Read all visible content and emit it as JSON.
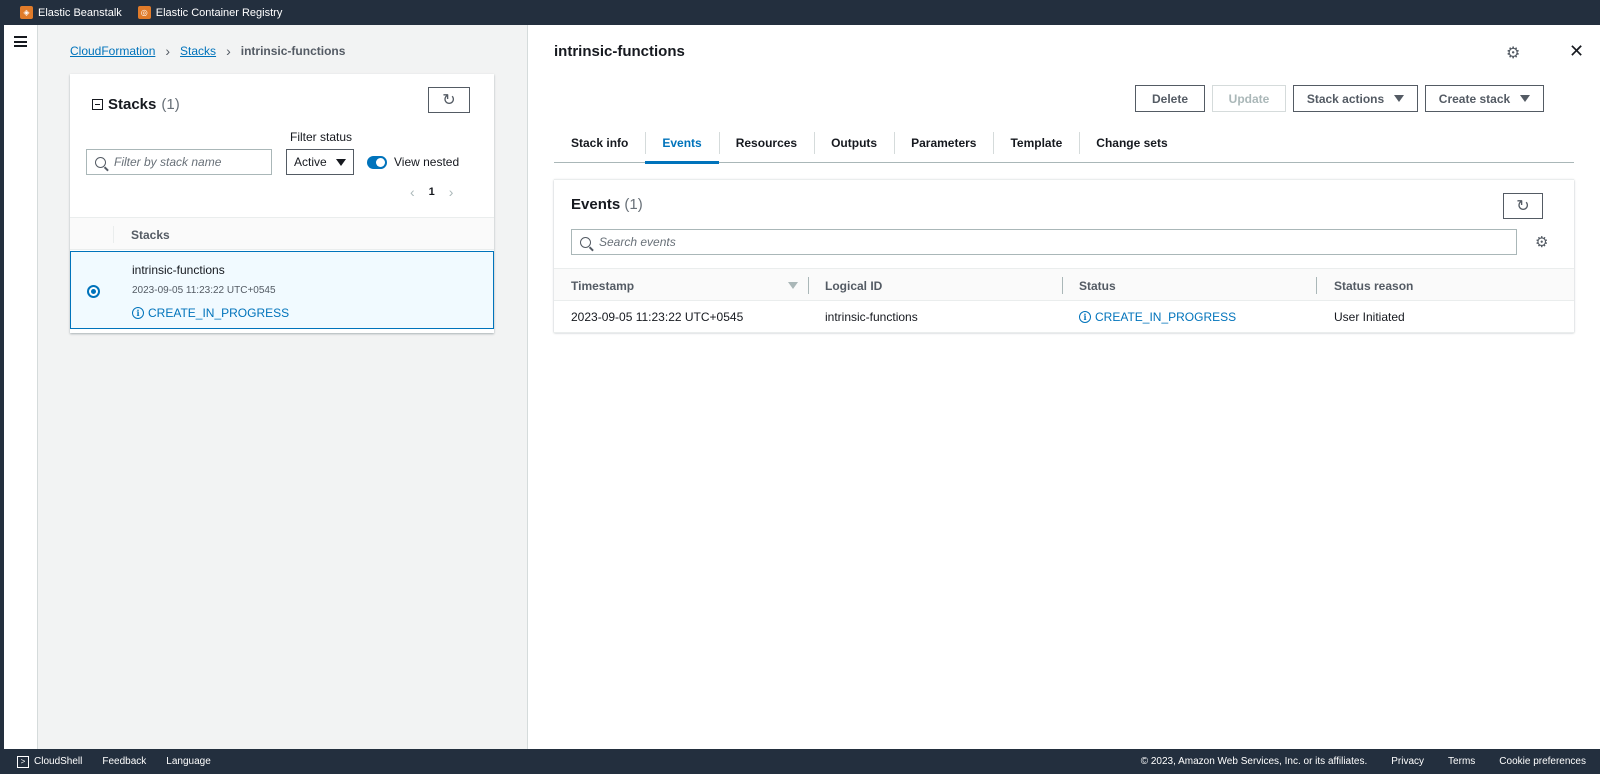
{
  "favorites": [
    {
      "label": "Elastic Beanstalk",
      "icon": "beanstalk-icon"
    },
    {
      "label": "Elastic Container Registry",
      "icon": "ecr-icon"
    }
  ],
  "breadcrumb": {
    "root": "CloudFormation",
    "stacks": "Stacks",
    "current": "intrinsic-functions"
  },
  "stacks_panel": {
    "title": "Stacks",
    "count": "(1)",
    "filter_placeholder": "Filter by stack name",
    "filter_status_label": "Filter status",
    "filter_status_value": "Active",
    "view_nested_label": "View nested",
    "page": "1",
    "column_header": "Stacks",
    "rows": [
      {
        "name": "intrinsic-functions",
        "time": "2023-09-05 11:23:22 UTC+0545",
        "status": "CREATE_IN_PROGRESS"
      }
    ]
  },
  "detail": {
    "title": "intrinsic-functions",
    "buttons": {
      "delete": "Delete",
      "update": "Update",
      "stack_actions": "Stack actions",
      "create_stack": "Create stack"
    },
    "tabs": [
      "Stack info",
      "Events",
      "Resources",
      "Outputs",
      "Parameters",
      "Template",
      "Change sets"
    ],
    "active_tab": "Events"
  },
  "events": {
    "title": "Events",
    "count": "(1)",
    "search_placeholder": "Search events",
    "columns": [
      "Timestamp",
      "Logical ID",
      "Status",
      "Status reason"
    ],
    "rows": [
      {
        "timestamp": "2023-09-05 11:23:22 UTC+0545",
        "logical_id": "intrinsic-functions",
        "status": "CREATE_IN_PROGRESS",
        "reason": "User Initiated"
      }
    ]
  },
  "footer": {
    "cloudshell": "CloudShell",
    "feedback": "Feedback",
    "language": "Language",
    "copyright": "© 2023, Amazon Web Services, Inc. or its affiliates.",
    "privacy": "Privacy",
    "terms": "Terms",
    "cookies": "Cookie preferences"
  },
  "colors": {
    "header_bg": "#232f3e",
    "link": "#0073bb",
    "favorite_icon": "#e07b2a"
  }
}
